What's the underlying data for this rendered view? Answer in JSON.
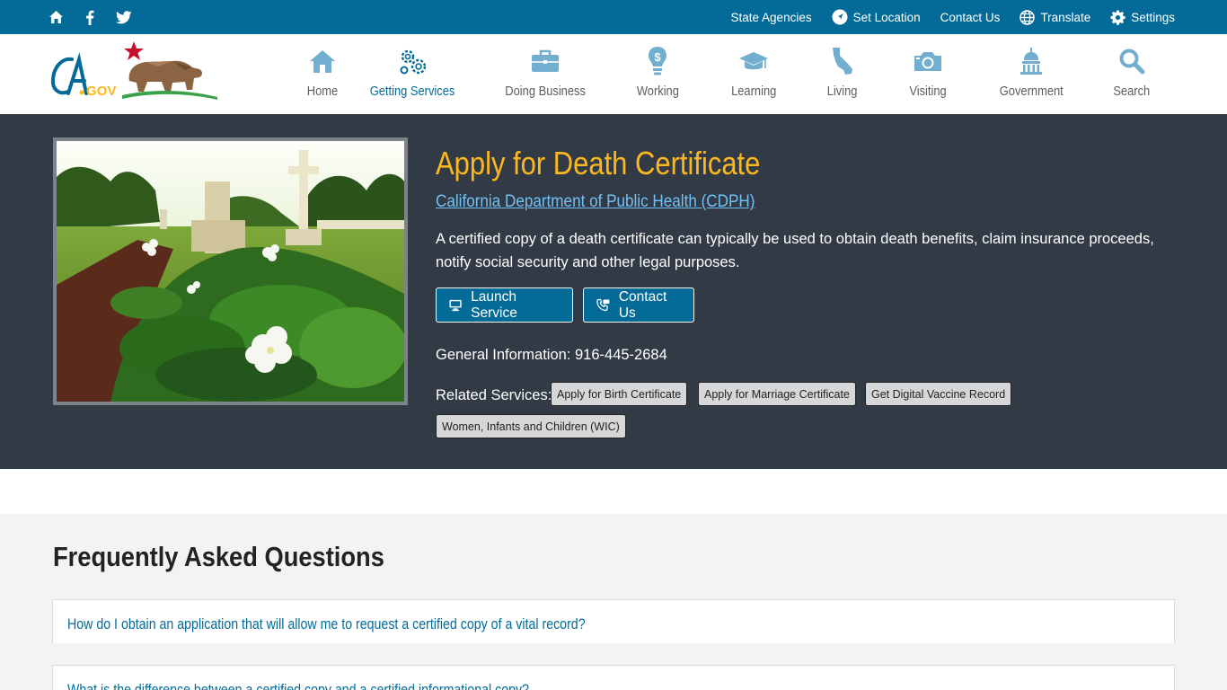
{
  "utility": {
    "left_icons": [
      "home-icon",
      "facebook-icon",
      "twitter-icon"
    ],
    "state_agencies": "State Agencies",
    "set_location": "Set Location",
    "contact_us": "Contact Us",
    "translate": "Translate",
    "settings": "Settings"
  },
  "logo": {
    "text": "CA.GOV",
    "icon": "ca-gov-bear-logo"
  },
  "nav": {
    "items": [
      {
        "label": "Home",
        "icon": "home-icon"
      },
      {
        "label": "Getting Services",
        "icon": "gears-icon",
        "active": true
      },
      {
        "label": "Doing Business",
        "icon": "briefcase-icon"
      },
      {
        "label": "Working",
        "icon": "lightbulb-dollar-icon"
      },
      {
        "label": "Learning",
        "icon": "graduation-cap-icon"
      },
      {
        "label": "Living",
        "icon": "california-map-icon"
      },
      {
        "label": "Visiting",
        "icon": "camera-icon"
      },
      {
        "label": "Government",
        "icon": "capitol-icon"
      },
      {
        "label": "Search",
        "icon": "search-icon"
      }
    ]
  },
  "hero": {
    "title": "Apply for Death Certificate",
    "department": "California Department of Public Health (CDPH)",
    "description": "A certified copy of a death certificate can typically be used to obtain death benefits, claim insurance proceeds, notify social security and other legal purposes.",
    "launch_button": "Launch Service",
    "contact_button": "Contact Us",
    "general_info": "General Information: 916-445-2684",
    "related_label": "Related Services:",
    "related": [
      "Apply for Birth Certificate",
      "Apply for Marriage Certificate",
      "Get Digital Vaccine Record",
      "Women, Infants and Children (WIC)"
    ]
  },
  "faq": {
    "title": "Frequently Asked Questions",
    "items": [
      "How do I obtain an application that will allow me to request a certified copy of a vital record?",
      "What is the difference between a certified copy and a certified informational copy?"
    ]
  },
  "colors": {
    "utility_bar": "#046b99",
    "hero_bg": "#323a45",
    "title_gold": "#fdb81e",
    "link_blue": "#72c1f5",
    "nav_icon": "#72aecf",
    "faq_bg": "#f3f3f3"
  }
}
